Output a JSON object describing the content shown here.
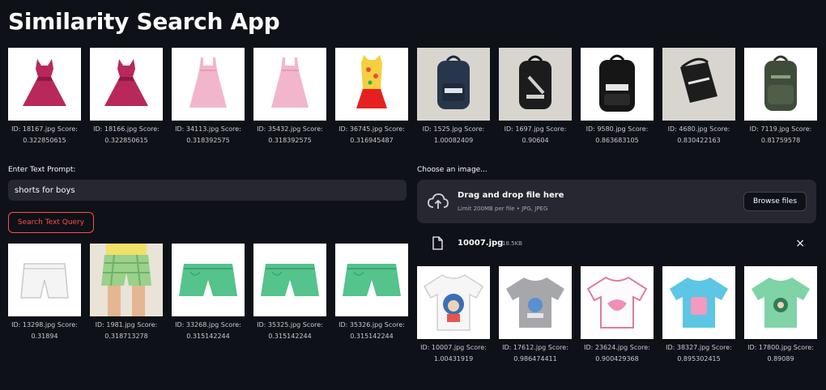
{
  "app": {
    "title": "Similarity Search App"
  },
  "top_results": [
    {
      "id_line": "ID: 18167.jpg Score:",
      "score_line": "0.322850615",
      "icon": "pink-party-dress"
    },
    {
      "id_line": "ID: 18166.jpg Score:",
      "score_line": "0.322850615",
      "icon": "pink-party-dress"
    },
    {
      "id_line": "ID: 34113.jpg Score:",
      "score_line": "0.318392575",
      "icon": "light-pink-dress"
    },
    {
      "id_line": "ID: 35432.jpg Score:",
      "score_line": "0.318392575",
      "icon": "light-pink-dress"
    },
    {
      "id_line": "ID: 36745.jpg Score:",
      "score_line": "0.316945487",
      "icon": "printed-red-dress"
    },
    {
      "id_line": "ID: 1525.jpg Score:",
      "score_line": "1.00082409",
      "icon": "navy-puma-backpack"
    },
    {
      "id_line": "ID: 1697.jpg Score:",
      "score_line": "0.90604",
      "icon": "black-puma-backpack"
    },
    {
      "id_line": "ID: 9580.jpg Score:",
      "score_line": "0.863683105",
      "icon": "black-puma-backpack"
    },
    {
      "id_line": "ID: 4680.jpg Score:",
      "score_line": "0.830422163",
      "icon": "black-adidas-bag"
    },
    {
      "id_line": "ID: 7119.jpg Score:",
      "score_line": "0.81759578",
      "icon": "olive-backpack"
    }
  ],
  "text_query": {
    "label": "Enter Text Prompt:",
    "value": "shorts for boys",
    "button_label": "Search Text Query"
  },
  "image_query": {
    "label": "Choose an image...",
    "dropzone_title": "Drag and drop file here",
    "dropzone_subtitle": "Limit 200MB per file • JPG, JPEG",
    "browse_label": "Browse files",
    "file_name": "10007.jpg",
    "file_size": "18.5KB",
    "remove_glyph": "×"
  },
  "text_results": [
    {
      "id_line": "ID: 13298.jpg Score:",
      "score_line": "0.31894",
      "icon": "white-shorts"
    },
    {
      "id_line": "ID: 1981.jpg Score:",
      "score_line": "0.318713278",
      "icon": "green-check-shorts-model"
    },
    {
      "id_line": "ID: 33268.jpg Score:",
      "score_line": "0.315142244",
      "icon": "green-shorts"
    },
    {
      "id_line": "ID: 35325.jpg Score:",
      "score_line": "0.315142244",
      "icon": "green-shorts"
    },
    {
      "id_line": "ID: 35326.jpg Score:",
      "score_line": "0.315142244",
      "icon": "green-shorts"
    }
  ],
  "image_results": [
    {
      "id_line": "ID: 10007.jpg Score:",
      "score_line": "1.00431919",
      "icon": "white-printed-tshirt"
    },
    {
      "id_line": "ID: 17612.jpg Score:",
      "score_line": "0.986474411",
      "icon": "grey-printed-tshirt"
    },
    {
      "id_line": "ID: 23624.jpg Score:",
      "score_line": "0.900429368",
      "icon": "white-pink-tshirt"
    },
    {
      "id_line": "ID: 38327.jpg Score:",
      "score_line": "0.895302415",
      "icon": "blue-printed-tshirt"
    },
    {
      "id_line": "ID: 17800.jpg Score:",
      "score_line": "0.89089",
      "icon": "green-printed-tshirt"
    }
  ],
  "colors": {
    "background": "#0e1117",
    "panel": "#262730",
    "accent": "#ff4b4b",
    "text": "#fafafa"
  }
}
